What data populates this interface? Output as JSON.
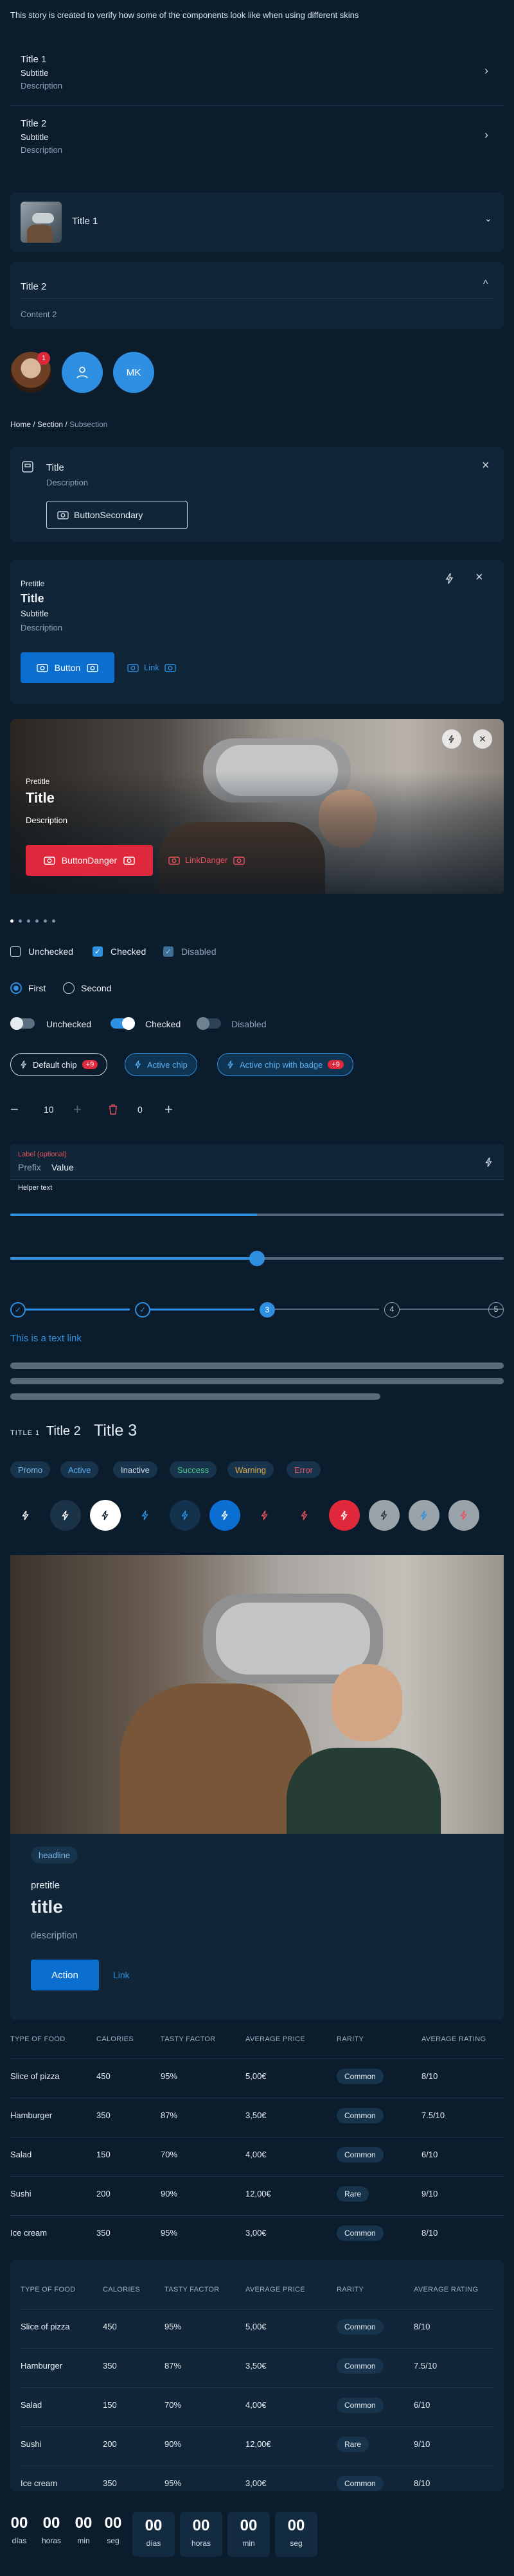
{
  "intro": "This story is created to verify how some of the components look like when using different skins",
  "list_items": [
    {
      "title": "Title 1",
      "subtitle": "Subtitle",
      "description": "Description"
    },
    {
      "title": "Title 2",
      "subtitle": "Subtitle",
      "description": "Description"
    }
  ],
  "accordion": {
    "item1_title": "Title 1",
    "item2_title": "Title 2",
    "item2_content": "Content 2"
  },
  "avatars": {
    "badge": "1",
    "initials": "MK"
  },
  "breadcrumb": {
    "home": "Home",
    "section": "Section",
    "current": "Subsection"
  },
  "callout": {
    "title": "Title",
    "description": "Description",
    "button": "ButtonSecondary"
  },
  "card1": {
    "pretitle": "Pretitle",
    "title": "Title",
    "subtitle": "Subtitle",
    "description": "Description",
    "button": "Button",
    "link": "Link"
  },
  "card2": {
    "pretitle": "Pretitle",
    "title": "Title",
    "description": "Description",
    "button": "ButtonDanger",
    "link": "LinkDanger"
  },
  "checkboxes": {
    "unchecked": "Unchecked",
    "checked": "Checked",
    "disabled": "Disabled"
  },
  "radios": {
    "first": "First",
    "second": "Second"
  },
  "switches": {
    "unchecked": "Unchecked",
    "checked": "Checked",
    "disabled": "Disabled"
  },
  "chips": {
    "default": "Default chip",
    "default_badge": "+9",
    "active": "Active chip",
    "active_badge_label": "Active chip with badge",
    "active_badge": "+9"
  },
  "steppers": {
    "value1": "10",
    "value2": "0"
  },
  "textfield": {
    "label": "Label (optional)",
    "prefix": "Prefix",
    "value": "Value",
    "helper": "Helper text"
  },
  "slider_value": 0.5,
  "progress_value": 0.5,
  "steps": {
    "s3": "3",
    "s4": "4",
    "s5": "5"
  },
  "textlink": "This is a text link",
  "titles": {
    "t1": "TITLE 1",
    "t2": "Title 2",
    "t3": "Title 3"
  },
  "tags": [
    "Promo",
    "Active",
    "Inactive",
    "Success",
    "Warning",
    "Error"
  ],
  "media_card": {
    "headline": "headline",
    "pretitle": "pretitle",
    "title": "title",
    "description": "description",
    "action": "Action",
    "link": "Link"
  },
  "table": {
    "headers": [
      "TYPE OF FOOD",
      "CALORIES",
      "TASTY FACTOR",
      "AVERAGE PRICE",
      "RARITY",
      "AVERAGE RATING"
    ],
    "rows": [
      [
        "Slice of pizza",
        "450",
        "95%",
        "5,00€",
        "Common",
        "8/10"
      ],
      [
        "Hamburger",
        "350",
        "87%",
        "3,50€",
        "Common",
        "7.5/10"
      ],
      [
        "Salad",
        "150",
        "70%",
        "4,00€",
        "Common",
        "6/10"
      ],
      [
        "Sushi",
        "200",
        "90%",
        "12,00€",
        "Rare",
        "9/10"
      ],
      [
        "Ice cream",
        "350",
        "95%",
        "3,00€",
        "Common",
        "8/10"
      ]
    ]
  },
  "countdown": {
    "values": [
      "00",
      "00",
      "00",
      "00"
    ],
    "labels": [
      "días",
      "horas",
      "min",
      "seg"
    ]
  }
}
